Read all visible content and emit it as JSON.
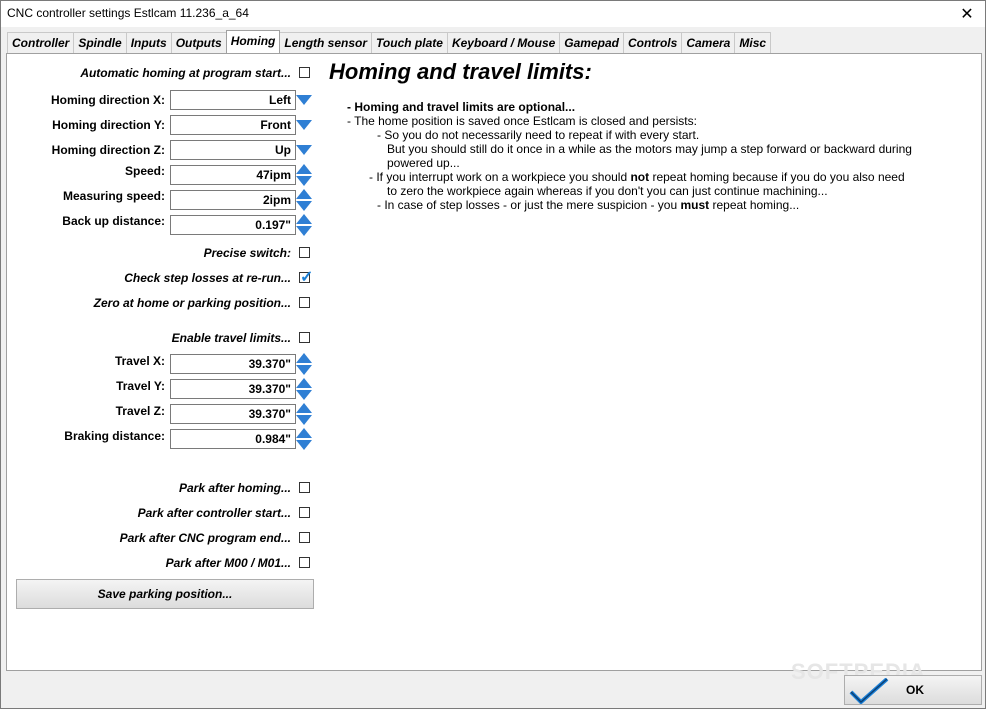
{
  "window": {
    "title": "CNC controller settings Estlcam 11.236_a_64",
    "close": "✕"
  },
  "tabs": [
    "Controller",
    "Spindle",
    "Inputs",
    "Outputs",
    "Homing",
    "Length sensor",
    "Touch plate",
    "Keyboard / Mouse",
    "Gamepad",
    "Controls",
    "Camera",
    "Misc"
  ],
  "active_tab": "Homing",
  "left": {
    "auto_homing": {
      "label": "Automatic homing at program start...",
      "checked": false
    },
    "dir_x": {
      "label": "Homing direction X:",
      "value": "Left"
    },
    "dir_y": {
      "label": "Homing direction Y:",
      "value": "Front"
    },
    "dir_z": {
      "label": "Homing direction Z:",
      "value": "Up"
    },
    "speed": {
      "label": "Speed:",
      "value": "47ipm"
    },
    "measuring_speed": {
      "label": "Measuring speed:",
      "value": "2ipm"
    },
    "back_up": {
      "label": "Back up distance:",
      "value": "0.197\""
    },
    "precise_switch": {
      "label": "Precise switch:",
      "checked": false
    },
    "check_step": {
      "label": "Check step losses at re-run...",
      "checked": true
    },
    "zero_home": {
      "label": "Zero at home or parking position...",
      "checked": false
    },
    "enable_travel": {
      "label": "Enable travel limits...",
      "checked": false
    },
    "travel_x": {
      "label": "Travel X:",
      "value": "39.370\""
    },
    "travel_y": {
      "label": "Travel Y:",
      "value": "39.370\""
    },
    "travel_z": {
      "label": "Travel Z:",
      "value": "39.370\""
    },
    "braking": {
      "label": "Braking distance:",
      "value": "0.984\""
    },
    "park_homing": {
      "label": "Park after homing...",
      "checked": false
    },
    "park_start": {
      "label": "Park after controller start...",
      "checked": false
    },
    "park_end": {
      "label": "Park after CNC program end...",
      "checked": false
    },
    "park_m00": {
      "label": "Park after M00 / M01...",
      "checked": false
    },
    "save_parking": "Save parking position..."
  },
  "help": {
    "heading": "Homing and travel limits:",
    "line1": "- Homing and travel limits are optional...",
    "line2": "- The home position is saved once Estlcam is closed and persists:",
    "line3": "- So you do not necessarily need to repeat if with every start.",
    "line4": "But you should still do it once in a while as the motors may jump a step forward or backward during",
    "line5": "powered up...",
    "line6a": "- If you interrupt work on a workpiece you should ",
    "line6b": "not",
    "line6c": " repeat homing because if you do you also need",
    "line7": "to zero the workpiece again whereas if you don't you can just continue machining...",
    "line8a": "- In case of step losses - or just the mere suspicion - you ",
    "line8b": "must",
    "line8c": " repeat homing..."
  },
  "ok_button": "OK",
  "watermark": "SOFTPEDIA",
  "colors": {
    "accent": "#2f7fd4",
    "check": "#1a7fd6"
  }
}
